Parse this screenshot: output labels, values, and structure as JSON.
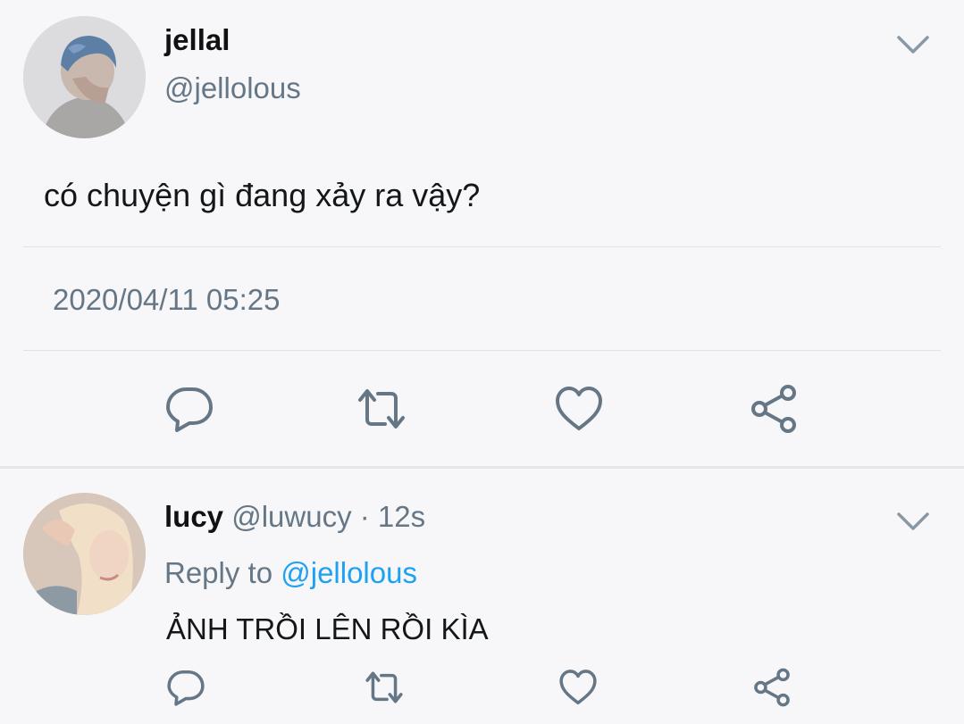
{
  "main_tweet": {
    "author_name": "jellal",
    "author_handle": "@jellolous",
    "text": "có chuyện gì đang xảy ra vậy?",
    "timestamp": "2020/04/11 05:25",
    "menu_icon": "chevron-down-icon",
    "actions": [
      {
        "icon": "reply-icon"
      },
      {
        "icon": "retweet-icon"
      },
      {
        "icon": "like-icon"
      },
      {
        "icon": "share-icon"
      }
    ]
  },
  "reply_tweet": {
    "author_name": "lucy",
    "author_handle": "@luwucy",
    "separator": " · ",
    "time_ago": "12s",
    "reply_to_label": "Reply to ",
    "reply_to_handle": "@jellolous",
    "text": "ẢNH TRỒI LÊN RỒI KÌA",
    "menu_icon": "chevron-down-icon",
    "actions": [
      {
        "icon": "reply-icon"
      },
      {
        "icon": "retweet-icon"
      },
      {
        "icon": "like-icon"
      },
      {
        "icon": "share-icon"
      }
    ]
  },
  "colors": {
    "background": "#f7f7f9",
    "primary_text": "#14171a",
    "secondary_text": "#657786",
    "link": "#1da1f2",
    "icon": "#657786",
    "divider": "#dfe3e6"
  }
}
